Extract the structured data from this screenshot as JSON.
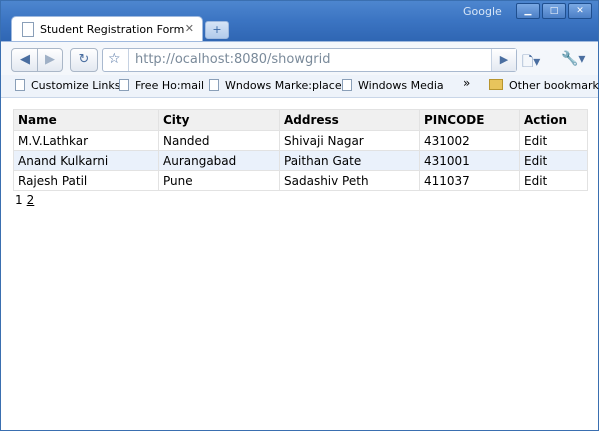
{
  "window": {
    "brand": "Google",
    "tab_title": "Student Registration Form",
    "url": "http://ocalhost:8080/showgrid"
  },
  "bookmarks": [
    {
      "label": "Customize Links"
    },
    {
      "label": "Free Ho:mail"
    },
    {
      "label": "Wndows Marke:place"
    },
    {
      "label": "Windows Media"
    }
  ],
  "other_bookmarks": "Other bookmarks",
  "grid": {
    "headers": [
      "Name",
      "City",
      "Address",
      "PINCODE",
      "Action"
    ],
    "rows": [
      {
        "name": "M.V.Lathkar",
        "city": "Nanded",
        "address": "Shivaji Nagar",
        "pincode": "431002",
        "action": "Edit"
      },
      {
        "name": "Anand Kulkarni",
        "city": "Aurangabad",
        "address": "Paithan Gate",
        "pincode": "431001",
        "action": "Edit"
      },
      {
        "name": "Rajesh Patil",
        "city": "Pune",
        "address": "Sadashiv Peth",
        "pincode": "411037",
        "action": "Edit"
      }
    ]
  },
  "pager": {
    "current": "1",
    "next": "2"
  },
  "icons": {
    "back": "back-arrow-icon",
    "forward": "forward-arrow-icon",
    "reload": "reload-icon",
    "star": "star-icon",
    "go": "go-arrow-icon",
    "page_menu": "page-menu-icon",
    "tools_menu": "wrench-icon"
  }
}
